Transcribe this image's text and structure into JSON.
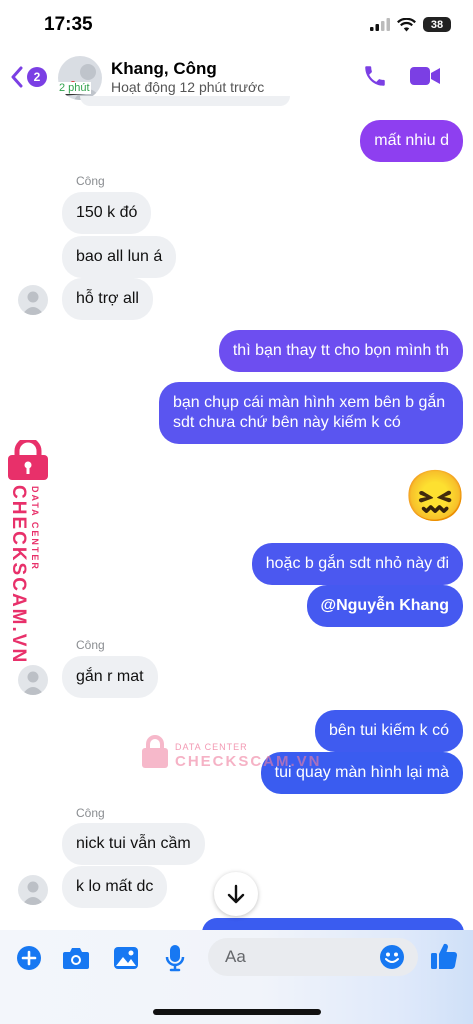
{
  "status_bar": {
    "time": "17:35",
    "battery": "38"
  },
  "header": {
    "unread_count": "2",
    "avatar_status": "2 phút",
    "contact_name": "Khang, Công",
    "activity": "Hoạt động 12 phút trước"
  },
  "messages": [
    {
      "dir": "out",
      "text": "mất nhiu d"
    },
    {
      "dir": "in",
      "sender": "Công",
      "text": "150 k đó"
    },
    {
      "dir": "in",
      "text": "bao all lun á"
    },
    {
      "dir": "in",
      "text": "hỗ trợ all"
    },
    {
      "dir": "out",
      "text": "thì bạn thay tt cho bọn mình th"
    },
    {
      "dir": "out",
      "text": "bạn chụp cái màn hình xem bên b gắn sdt chưa chứ bên này kiếm k có"
    },
    {
      "dir": "out",
      "text": "😖"
    },
    {
      "dir": "out",
      "text": "hoặc b gắn sdt nhỏ này đi"
    },
    {
      "dir": "out",
      "text": "@Nguyễn Khang"
    },
    {
      "dir": "in",
      "sender": "Công",
      "text": "gắn r mat"
    },
    {
      "dir": "out",
      "text": "bên tui kiếm k có"
    },
    {
      "dir": "out",
      "text": "tui quay màn hình lại mà"
    },
    {
      "dir": "in",
      "sender": "Công",
      "text": "nick tui vẫn cầm"
    },
    {
      "dir": "in",
      "text": "k lo mất dc"
    }
  ],
  "watermark": {
    "line1": "DATA CENTER",
    "line2": "CHECKSCAM.VN"
  },
  "composer": {
    "placeholder": "Aa"
  },
  "colors": {
    "accent": "#7b3fe4",
    "bubble_top": "#8e3ff0",
    "bubble_bottom": "#3a5cf0",
    "incoming": "#eef0f3",
    "watermark": "#e8306a"
  },
  "icons": [
    "back-chevron-icon",
    "phone-icon",
    "video-camera-icon",
    "plus-icon",
    "camera-icon",
    "image-icon",
    "microphone-icon",
    "emoji-icon",
    "thumbs-up-icon",
    "scroll-down-arrow-icon"
  ]
}
